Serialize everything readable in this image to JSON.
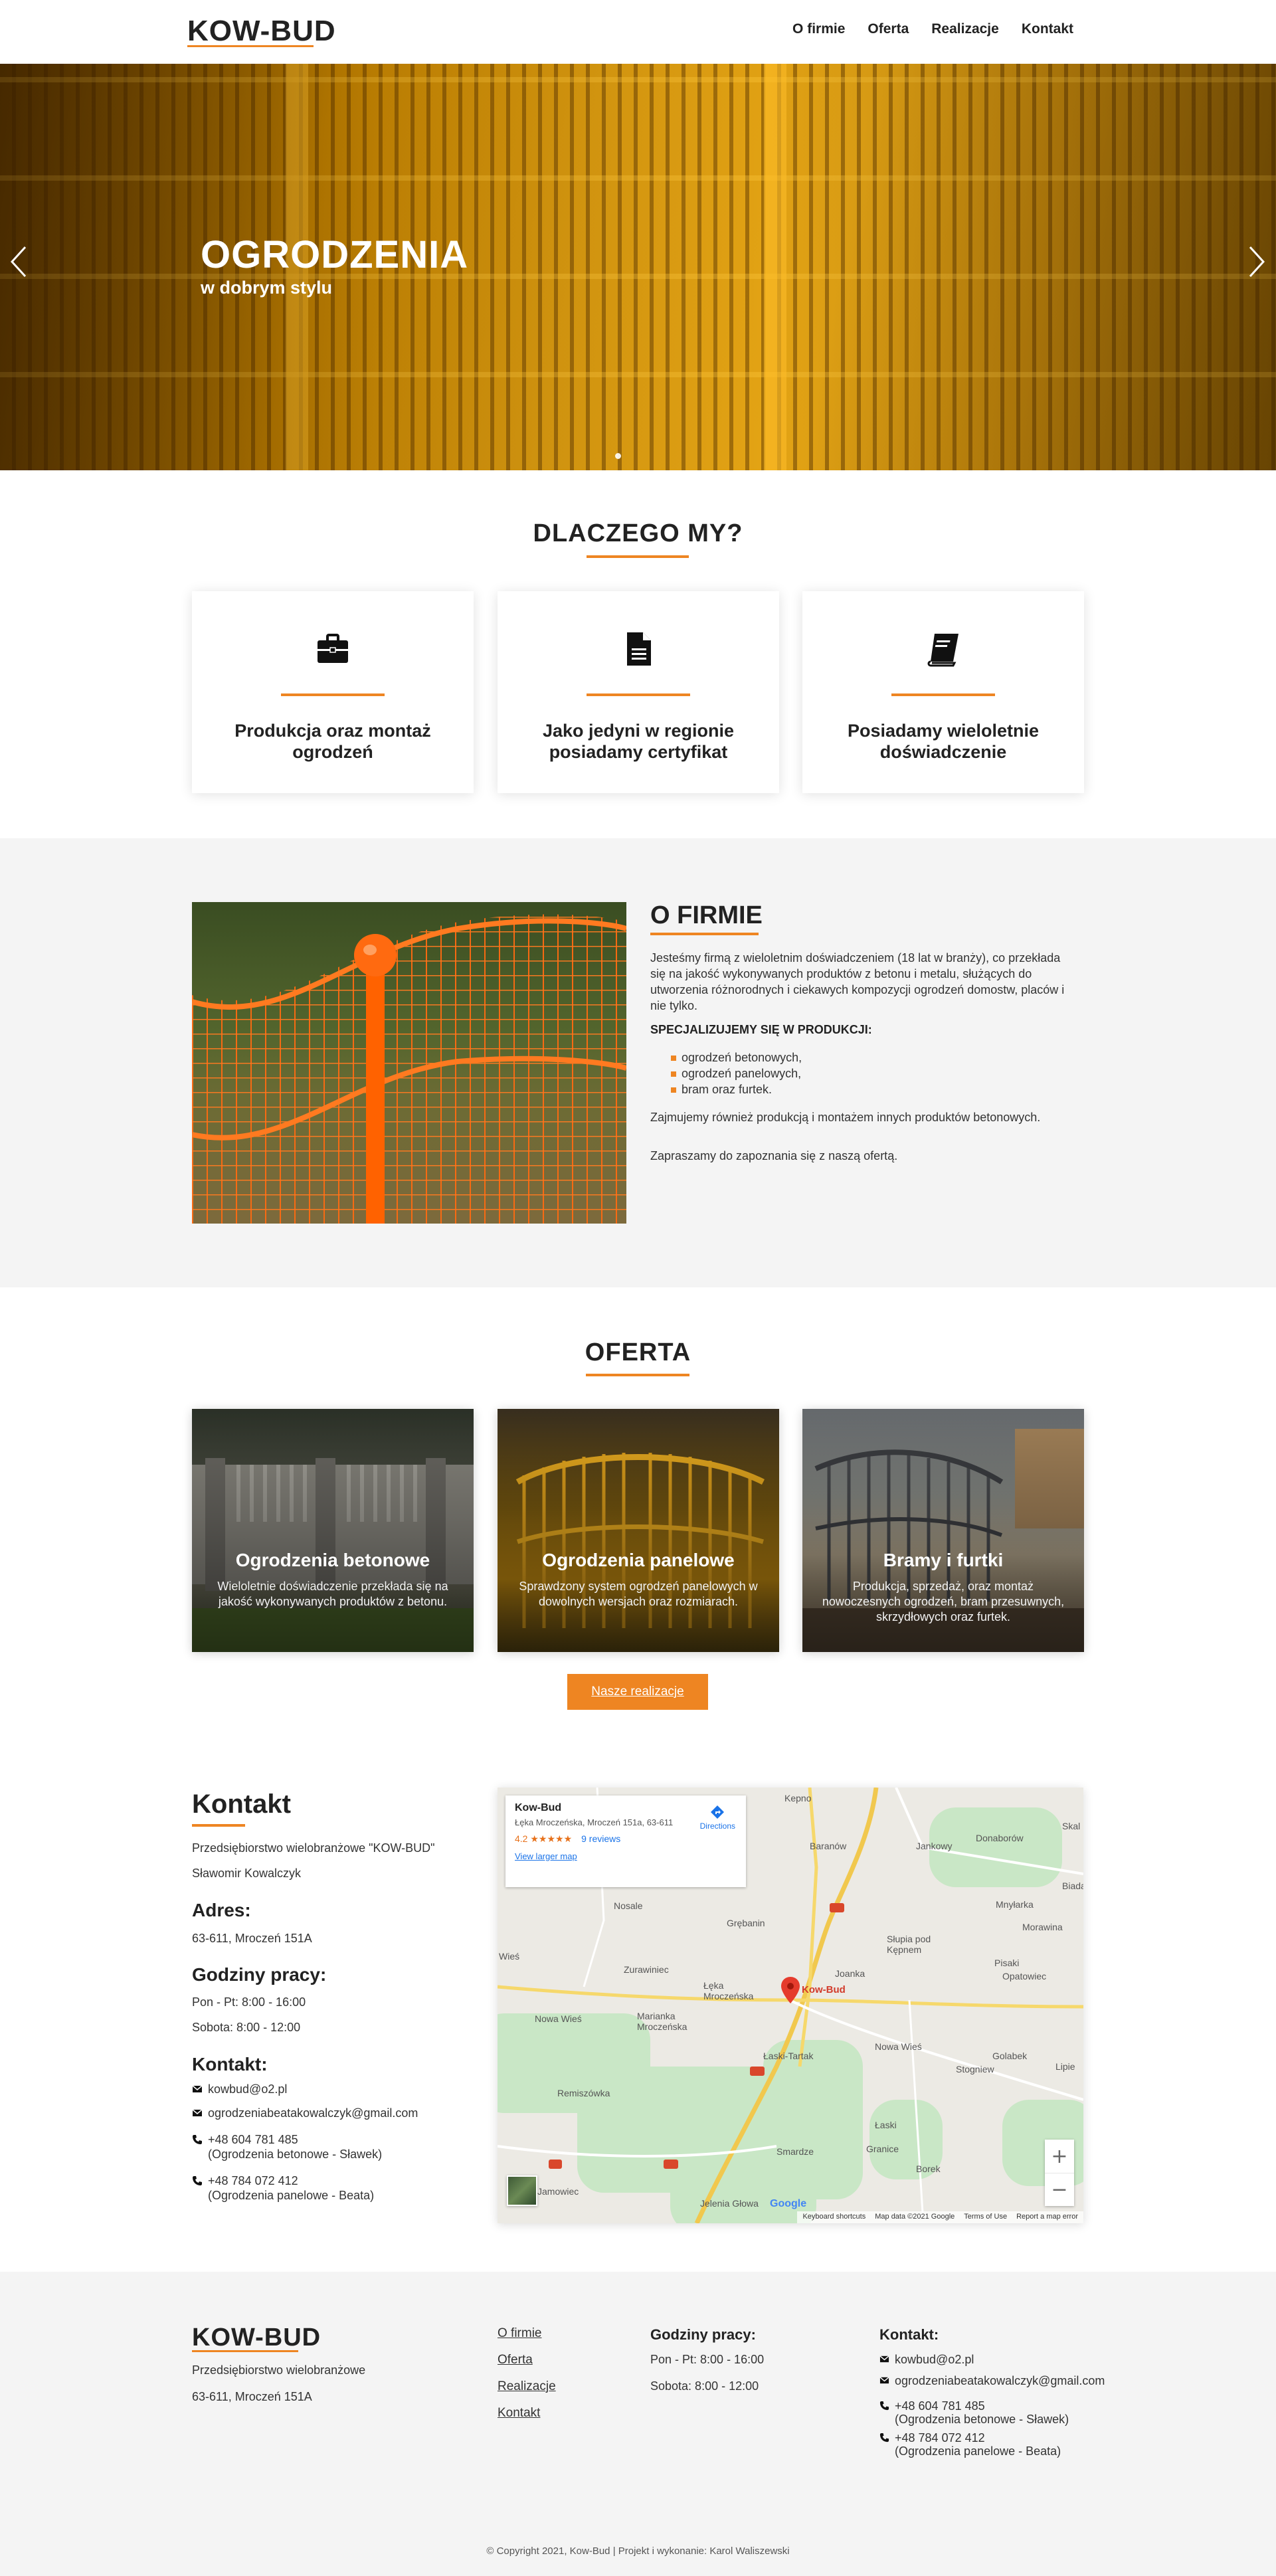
{
  "header": {
    "logo": "KOW-BUD",
    "nav": [
      "O firmie",
      "Oferta",
      "Realizacje",
      "Kontakt"
    ]
  },
  "hero": {
    "title": "OGRODZENIA",
    "subtitle": "w dobrym stylu"
  },
  "why": {
    "title": "DLACZEGO MY?",
    "cards": [
      {
        "icon": "briefcase-icon",
        "text": "Produkcja oraz montaż ogrodzeń"
      },
      {
        "icon": "document-icon",
        "text": "Jako jedyni w regionie posiadamy certyfikat"
      },
      {
        "icon": "book-icon",
        "text": "Posiadamy wieloletnie doświadczenie"
      }
    ]
  },
  "about": {
    "title": "O FIRMIE",
    "p1": "Jesteśmy firmą z wieloletnim doświadczeniem (18 lat w branży), co przekłada się na jakość wykonywanych produktów z betonu i metalu, służących do utworzenia różnorodnych i ciekawych kompozycji ogrodzeń domostw, placów i nie tylko.",
    "specialize": "SPECJALIZUJEMY SIĘ W PRODUKCJI:",
    "list": [
      "ogrodzeń betonowych,",
      "ogrodzeń panelowych,",
      "bram oraz furtek."
    ],
    "p2": "Zajmujemy również produkcją i montażem innych produktów betonowych.",
    "p3": "Zapraszamy do zapoznania się z naszą ofertą."
  },
  "offer": {
    "title": "OFERTA",
    "cards": [
      {
        "title": "Ogrodzenia betonowe",
        "desc": "Wieloletnie doświadczenie przekłada się na jakość wykonywanych produktów z betonu."
      },
      {
        "title": "Ogrodzenia panelowe",
        "desc": "Sprawdzony system ogrodzeń panelowych w dowolnych wersjach oraz rozmiarach."
      },
      {
        "title": "Bramy i furtki",
        "desc": "Produkcja, sprzedaż, oraz montaż nowoczesnych ogrodzeń, bram przesuwnych, skrzydłowych oraz furtek."
      }
    ],
    "button": "Nasze realizacje"
  },
  "contact": {
    "title": "Kontakt",
    "company": "Przedsiębiorstwo wielobranżowe \"KOW-BUD\"",
    "owner": "Sławomir Kowalczyk",
    "address_h": "Adres:",
    "address": "63-611, Mroczeń 151A",
    "hours_h": "Godziny pracy:",
    "hours1": "Pon - Pt: 8:00 - 16:00",
    "hours2": "Sobota: 8:00 - 12:00",
    "contact_h": "Kontakt:",
    "email1": "kowbud@o2.pl",
    "email2": "ogrodzeniabeatakowalczyk@gmail.com",
    "phone1": "+48 604 781 485",
    "phone1_note": "(Ogrodzenia betonowe - Sławek)",
    "phone2": "+48 784 072 412",
    "phone2_note": "(Ogrodzenia panelowe - Beata)"
  },
  "map": {
    "place": "Kow-Bud",
    "address": "Łęka Mroczeńska, Mroczeń 151a, 63-611",
    "rating": "4.2",
    "stars": "★★★★★",
    "reviews": "9 reviews",
    "larger": "View larger map",
    "directions": "Directions",
    "pin_label": "Kow-Bud",
    "towns": [
      "Kepno",
      "Baranów",
      "Jankowy",
      "Donaborów",
      "Skal",
      "Nosale",
      "Grębanin",
      "Mnyłarka",
      "Morawina",
      "Biada",
      "Słupia pod Kępnem",
      "Pisaki",
      "Opatowiec",
      "Łęka Mroczeńska",
      "Joanka",
      "Zurawiniec",
      "Marianka Mroczeńska",
      "Nowa Wieś",
      "Łaski-Tartak",
      "Nowa Wieś",
      "Golabek",
      "Stogniew",
      "Remiszówka",
      "Łaski",
      "Smardze",
      "Granice",
      "Borek",
      "Jamowiec",
      "Jelenia Głowa",
      "Lipie",
      "Wieś"
    ],
    "zoom_in": "+",
    "zoom_out": "−",
    "google": "Google",
    "foot": [
      "Keyboard shortcuts",
      "Map data ©2021 Google",
      "Terms of Use",
      "Report a map error"
    ]
  },
  "footer": {
    "logo": "KOW-BUD",
    "company": "Przedsiębiorstwo wielobranżowe",
    "address": "63-611, Mroczeń 151A",
    "links": [
      "O firmie",
      "Oferta",
      "Realizacje",
      "Kontakt"
    ],
    "hours_h": "Godziny pracy:",
    "hours1": "Pon - Pt: 8:00 - 16:00",
    "hours2": "Sobota: 8:00 - 12:00",
    "contact_h": "Kontakt:",
    "email1": "kowbud@o2.pl",
    "email2": "ogrodzeniabeatakowalczyk@gmail.com",
    "phone1": "+48 604 781 485",
    "phone1_note": "(Ogrodzenia betonowe - Sławek)",
    "phone2": "+48 784 072 412",
    "phone2_note": "(Ogrodzenia panelowe - Beata)",
    "copyright": "© Copyright 2021, Kow-Bud | Projekt i wykonanie: Karol Waliszewski"
  },
  "colors": {
    "accent": "#ee8522",
    "text": "#2b2b2b",
    "light_bg": "#f4f4f4"
  }
}
